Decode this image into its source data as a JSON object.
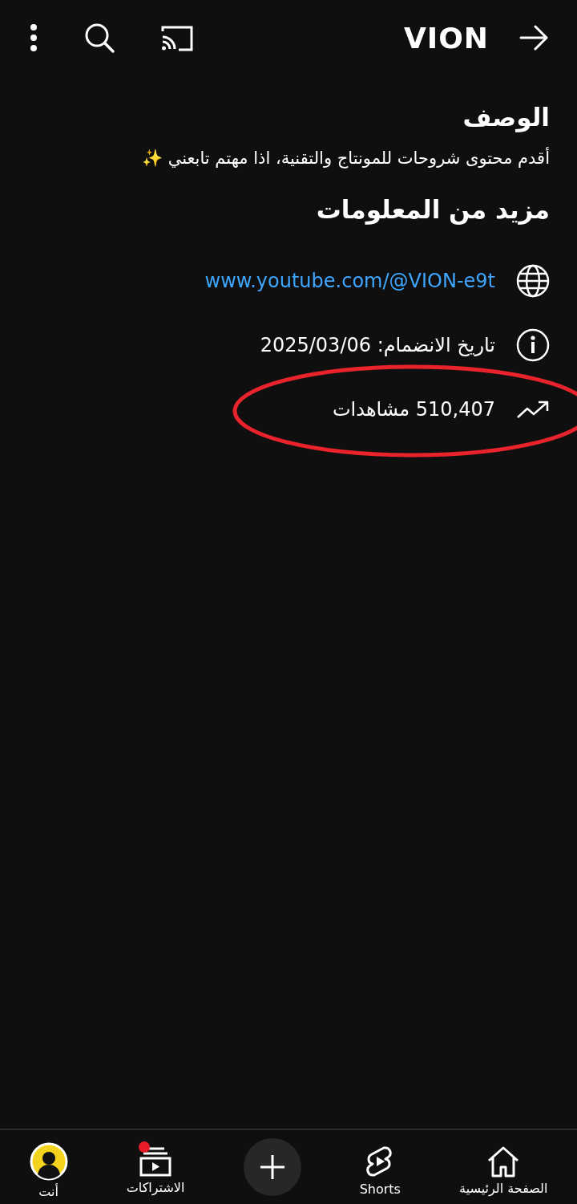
{
  "top_bar": {
    "title": "VION"
  },
  "description": {
    "heading": "الوصف",
    "text": "أقدم محتوى شروحات للمونتاج والتقنية، اذا مهتم تابعني ✨"
  },
  "more_info": {
    "heading": "مزيد من المعلومات",
    "rows": [
      {
        "kind": "link",
        "text": "www.youtube.com/@VION-e9t",
        "circled": false
      },
      {
        "kind": "joined",
        "text": "تاريخ الانضمام: 2025/03/06",
        "circled": false
      },
      {
        "kind": "views",
        "text": "510,407 مشاهدات",
        "circled": true
      }
    ]
  },
  "bottom_nav": [
    {
      "kind": "home",
      "label": "الصفحة الرئيسية",
      "badge": false
    },
    {
      "kind": "shorts",
      "label": "Shorts",
      "badge": false
    },
    {
      "kind": "create",
      "badge": false
    },
    {
      "kind": "subscriptions",
      "label": "الاشتراكات",
      "badge": true
    },
    {
      "kind": "you",
      "label": "أنت",
      "badge": false
    }
  ]
}
